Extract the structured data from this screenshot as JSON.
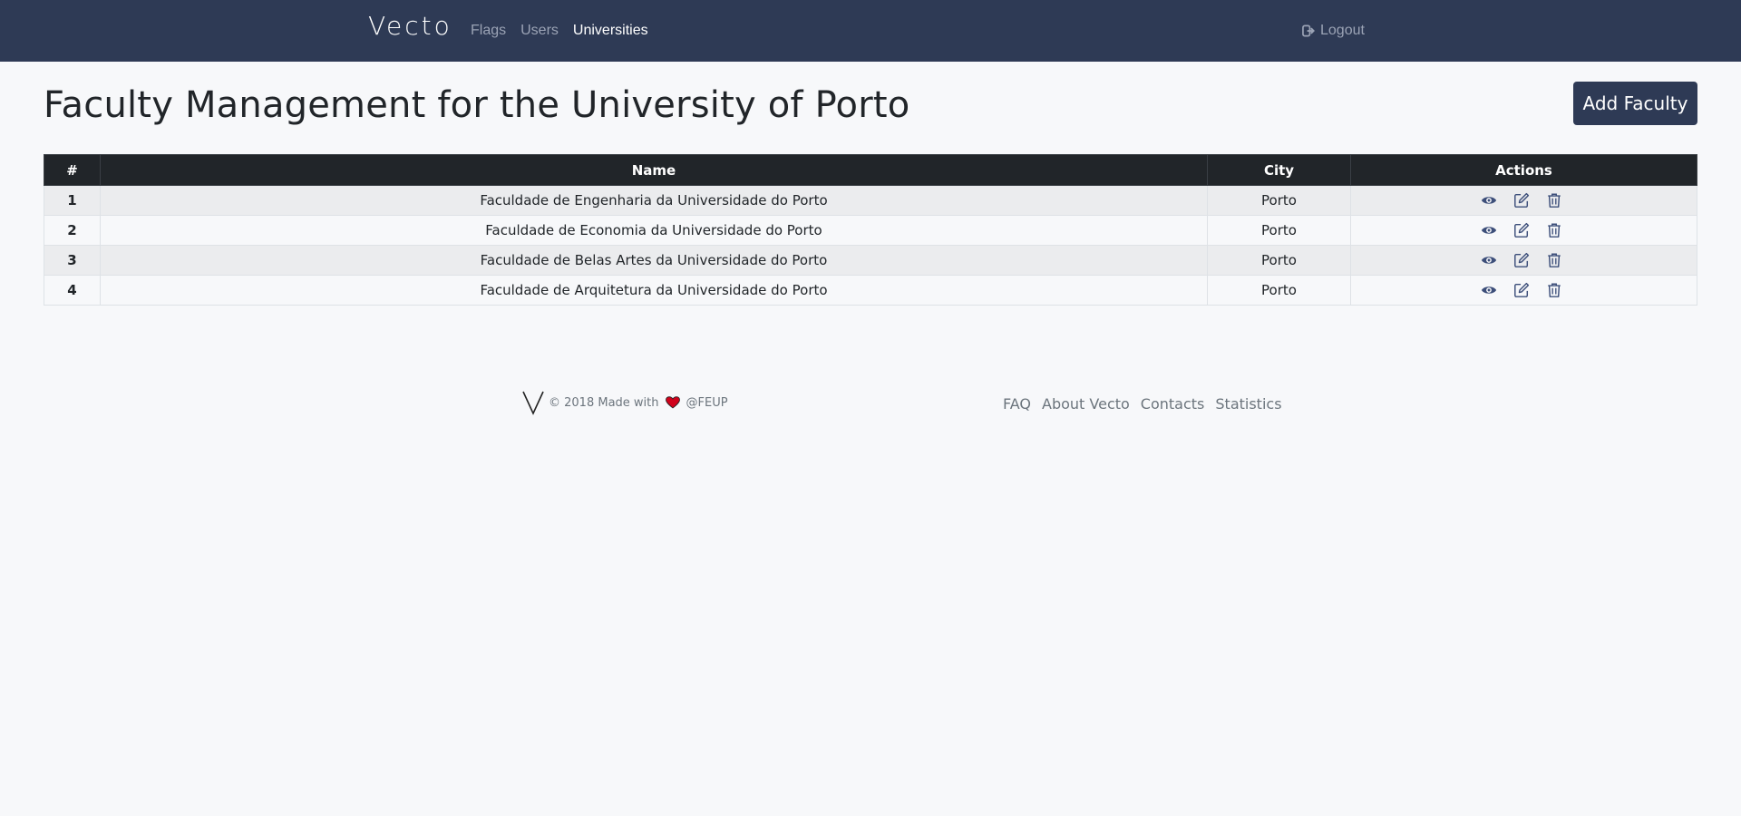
{
  "navbar": {
    "brand": "Vecto",
    "links": [
      {
        "label": "Flags"
      },
      {
        "label": "Users"
      },
      {
        "label": "Universities"
      }
    ],
    "logout_label": "Logout"
  },
  "header": {
    "title": "Faculty Management for the University of Porto",
    "add_button_label": "Add Faculty"
  },
  "table": {
    "columns": [
      "#",
      "Name",
      "City",
      "Actions"
    ],
    "rows": [
      {
        "num": "1",
        "name": "Faculdade de Engenharia da Universidade do Porto",
        "city": "Porto"
      },
      {
        "num": "2",
        "name": "Faculdade de Economia da Universidade do Porto",
        "city": "Porto"
      },
      {
        "num": "3",
        "name": "Faculdade de Belas Artes da Universidade do Porto",
        "city": "Porto"
      },
      {
        "num": "4",
        "name": "Faculdade de Arquitetura da Universidade do Porto",
        "city": "Porto"
      }
    ]
  },
  "footer": {
    "made_prefix": "© 2018 Made with",
    "made_suffix": "@FEUP",
    "links": [
      {
        "label": "FAQ"
      },
      {
        "label": "About Vecto"
      },
      {
        "label": "Contacts"
      },
      {
        "label": "Statistics"
      }
    ]
  },
  "colors": {
    "navbar": "#2e3a55",
    "icon": "#3d4f7a",
    "heart": "#d0021b"
  }
}
